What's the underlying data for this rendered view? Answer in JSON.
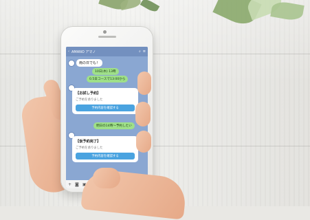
{
  "chat": {
    "header_title": "AMANO アマノ",
    "greeting": "雨の日でも！",
    "bubble1": "10日(木) 13時",
    "bubble1_detail": "0.5日コースで13:00から",
    "card1": {
      "title": "【お試し予約】",
      "desc": "ご予約を承りました",
      "button": "予約内容を確認する"
    },
    "bubble2": "明日の14時〜予約したい",
    "card2": {
      "title": "【仮予約完了】",
      "desc": "ご予約を承りました",
      "button": "予約内容を確認する"
    },
    "input_icons": [
      "+",
      "camera",
      "image",
      "mic"
    ]
  },
  "colors": {
    "chat_bg": "#8aa7d2",
    "header": "#7390bf",
    "button": "#4aa3e0",
    "green_bubble": "#9fe089"
  }
}
